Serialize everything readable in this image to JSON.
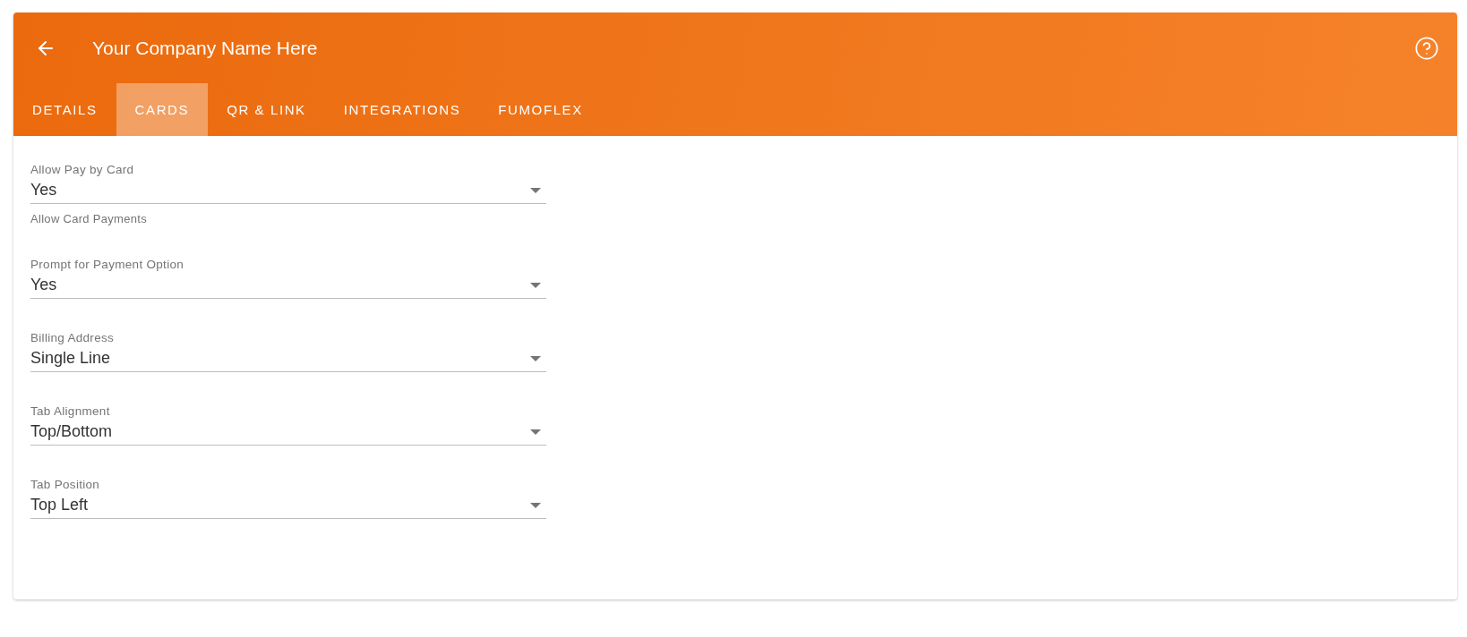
{
  "header": {
    "title": "Your Company Name Here"
  },
  "tabs": [
    {
      "label": "DETAILS",
      "selected": false
    },
    {
      "label": "CARDS",
      "selected": true
    },
    {
      "label": "QR & LINK",
      "selected": false
    },
    {
      "label": "INTEGRATIONS",
      "selected": false
    },
    {
      "label": "FUMOFLEX",
      "selected": false
    }
  ],
  "fields": [
    {
      "label": "Allow Pay by Card",
      "value": "Yes",
      "helper": "Allow Card Payments"
    },
    {
      "label": "Prompt for Payment Option",
      "value": "Yes"
    },
    {
      "label": "Billing Address",
      "value": "Single Line"
    },
    {
      "label": "Tab Alignment",
      "value": "Top/Bottom"
    },
    {
      "label": "Tab Position",
      "value": "Top Left"
    }
  ]
}
